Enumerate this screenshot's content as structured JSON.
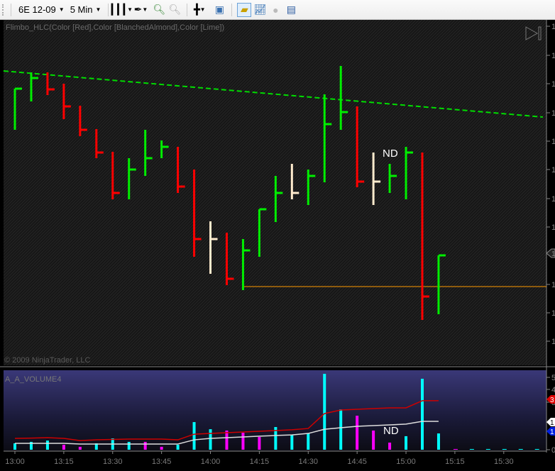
{
  "toolbar": {
    "instrument": "6E 12-09",
    "interval": "5 Min",
    "icons": [
      "bar-style-icon",
      "drawing-pen-icon",
      "zoom-in-icon",
      "zoom-out-icon",
      "crosshair-icon",
      "data-box-icon",
      "strategies-icon",
      "indicators-icon",
      "currency-icon",
      "properties-icon"
    ]
  },
  "price_panel": {
    "indicator_label": "Flimbo_HLC(Color [Red],Color [BlanchedAlmond],Color [Lime])",
    "copyright": "© 2009 NinjaTrader, LLC",
    "annotation": "ND",
    "axis_labels": [
      "1",
      "1",
      "1",
      "1",
      "1",
      "1",
      "1",
      "1",
      "1",
      "1",
      "1",
      "1"
    ],
    "current_price_tag": "1"
  },
  "volume_panel": {
    "indicator_label": "A_A_VOLUME4",
    "annotation": "ND",
    "axis_labels": [
      "5",
      "4",
      "3",
      "0"
    ],
    "tags": [
      {
        "text": "3",
        "color": "#e00000"
      },
      {
        "text": "1",
        "color": "#ffffff"
      },
      {
        "text": "1",
        "color": "#0020e0"
      }
    ]
  },
  "colors": {
    "down": "#ff0000",
    "up": "#00ee00",
    "neutral": "#ffebcd",
    "vol_up": "#00ffff",
    "vol_down": "#ff00ff",
    "trend": "#00dd00",
    "support": "#ff9900",
    "ma_red": "#cc0000",
    "ma_white": "#dddddd"
  },
  "chart_data": {
    "type": "hlc-bar",
    "note": "price values in relative units (not printed on screen)",
    "time_labels": [
      "13:00",
      "13:15",
      "13:30",
      "13:45",
      "14:00",
      "14:15",
      "14:30",
      "14:45",
      "15:00",
      "15:15",
      "15:30"
    ],
    "bars": [
      {
        "h": 375,
        "l": 317,
        "c": 375,
        "t": "up"
      },
      {
        "h": 398,
        "l": 357,
        "c": 390,
        "t": "up"
      },
      {
        "h": 398,
        "l": 366,
        "c": 374,
        "t": "down"
      },
      {
        "h": 382,
        "l": 332,
        "c": 350,
        "t": "down"
      },
      {
        "h": 351,
        "l": 308,
        "c": 317,
        "t": "down"
      },
      {
        "h": 318,
        "l": 277,
        "c": 285,
        "t": "down"
      },
      {
        "h": 286,
        "l": 219,
        "c": 228,
        "t": "down"
      },
      {
        "h": 277,
        "l": 219,
        "c": 261,
        "t": "up"
      },
      {
        "h": 317,
        "l": 252,
        "c": 277,
        "t": "up"
      },
      {
        "h": 302,
        "l": 277,
        "c": 293,
        "t": "up"
      },
      {
        "h": 293,
        "l": 228,
        "c": 237,
        "t": "down"
      },
      {
        "h": 261,
        "l": 138,
        "c": 163,
        "t": "down"
      },
      {
        "h": 188,
        "l": 114,
        "c": 163,
        "t": "neutral"
      },
      {
        "h": 172,
        "l": 98,
        "c": 107,
        "t": "down"
      },
      {
        "h": 163,
        "l": 91,
        "c": 147,
        "t": "up"
      },
      {
        "h": 205,
        "l": 138,
        "c": 205,
        "t": "up"
      },
      {
        "h": 252,
        "l": 187,
        "c": 228,
        "t": "up"
      },
      {
        "h": 269,
        "l": 219,
        "c": 228,
        "t": "neutral"
      },
      {
        "h": 261,
        "l": 211,
        "c": 252,
        "t": "up"
      },
      {
        "h": 367,
        "l": 243,
        "c": 325,
        "t": "up"
      },
      {
        "h": 407,
        "l": 317,
        "c": 342,
        "t": "up"
      },
      {
        "h": 350,
        "l": 236,
        "c": 244,
        "t": "down"
      },
      {
        "h": 285,
        "l": 211,
        "c": 244,
        "t": "neutral"
      },
      {
        "h": 269,
        "l": 228,
        "c": 252,
        "t": "up"
      },
      {
        "h": 293,
        "l": 219,
        "c": 285,
        "t": "up"
      },
      {
        "h": 285,
        "l": 49,
        "c": 82,
        "t": "down"
      },
      {
        "h": 140,
        "l": 57,
        "c": 140,
        "t": "up"
      }
    ],
    "trendline": [
      {
        "bar": -0.7,
        "v": 400
      },
      {
        "bar": 32.4,
        "v": 335
      }
    ],
    "support": {
      "from_bar": 14,
      "v": 96
    },
    "volume": [
      0.44,
      0.54,
      0.63,
      0.34,
      0.2,
      0.44,
      0.78,
      0.54,
      0.54,
      0.2,
      0.34,
      1.9,
      1.41,
      1.32,
      1.17,
      0.88,
      1.56,
      1.02,
      1.12,
      5.22,
      2.78,
      2.34,
      1.32,
      0.49,
      0.93,
      4.88,
      1.12,
      0.05,
      0.05,
      0.05,
      0.05,
      0.05,
      0.05
    ],
    "volume_type": [
      "up",
      "up",
      "up",
      "down",
      "down",
      "up",
      "up",
      "up",
      "down",
      "down",
      "up",
      "up",
      "up",
      "down",
      "down",
      "down",
      "up",
      "up",
      "up",
      "up",
      "up",
      "down",
      "down",
      "down",
      "up",
      "up",
      "up",
      "down",
      "up",
      "up",
      "up",
      "up",
      "up"
    ],
    "ma_red": [
      0.78,
      0.8,
      0.83,
      0.78,
      0.63,
      0.68,
      0.71,
      0.73,
      0.73,
      0.73,
      0.68,
      1.07,
      1.12,
      1.17,
      1.22,
      1.27,
      1.32,
      1.37,
      1.46,
      2.49,
      2.73,
      2.78,
      2.83,
      2.88,
      2.88,
      3.37,
      3.37
    ],
    "ma_white": [
      0.44,
      0.44,
      0.44,
      0.44,
      0.39,
      0.39,
      0.39,
      0.39,
      0.39,
      0.39,
      0.39,
      0.68,
      0.78,
      0.83,
      0.88,
      0.93,
      0.98,
      1.02,
      1.12,
      1.41,
      1.51,
      1.61,
      1.66,
      1.71,
      1.76,
      1.95,
      1.95
    ],
    "volume_ylim": [
      0,
      5
    ]
  }
}
